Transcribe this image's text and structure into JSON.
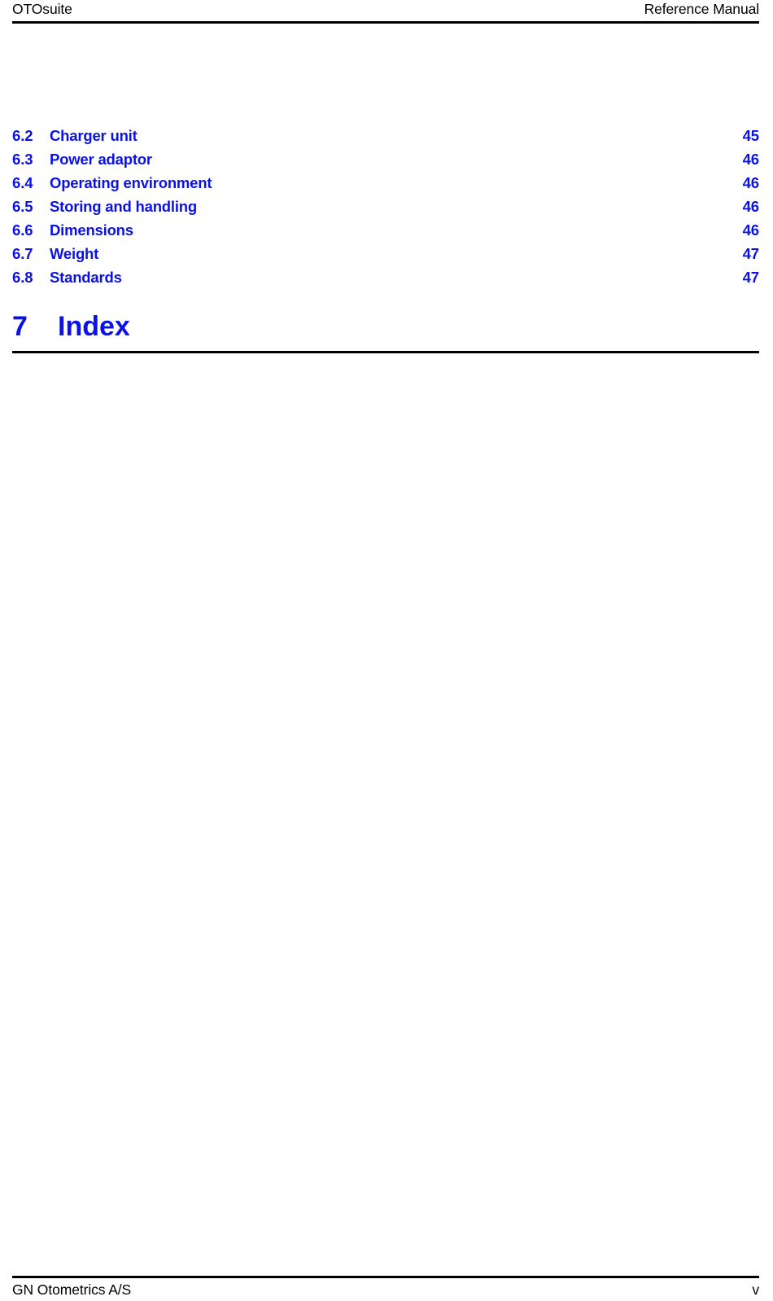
{
  "header": {
    "left": "OTOsuite",
    "right": "Reference Manual"
  },
  "colors": {
    "toc_blue": "#0B12E8",
    "rule_black": "#000000",
    "page_background": "#FFFFFF"
  },
  "toc": {
    "leader_char": ".",
    "entries": [
      {
        "number": "6.2",
        "title": "Charger unit",
        "leader_space": false,
        "page": "45"
      },
      {
        "number": "6.3",
        "title": "Power adaptor",
        "leader_space": false,
        "page": "46"
      },
      {
        "number": "6.4",
        "title": "Operating environment",
        "leader_space": true,
        "page": "46"
      },
      {
        "number": "6.5",
        "title": "Storing and handling",
        "leader_space": true,
        "page": "46"
      },
      {
        "number": "6.6",
        "title": "Dimensions",
        "leader_space": false,
        "page": "46"
      },
      {
        "number": "6.7",
        "title": "Weight",
        "leader_space": true,
        "page": "47"
      },
      {
        "number": "6.8",
        "title": "Standards",
        "leader_space": true,
        "page": "47"
      }
    ]
  },
  "chapter": {
    "number": "7",
    "title": "Index"
  },
  "footer": {
    "left": "GN Otometrics A/S",
    "right": "v"
  }
}
